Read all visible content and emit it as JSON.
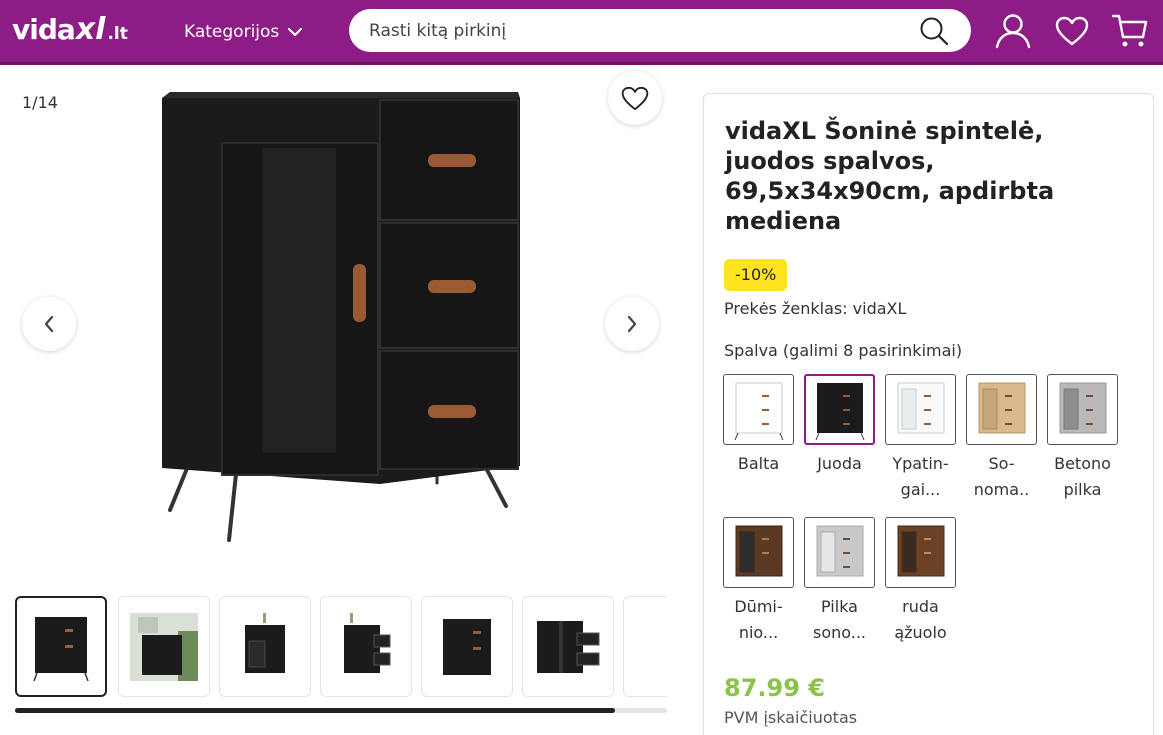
{
  "header": {
    "logo": {
      "vida": "vida",
      "xl": "xl",
      "domain": ".lt"
    },
    "categories_label": "Kategorijos",
    "search_placeholder": "Rasti kitą pirkinį"
  },
  "gallery": {
    "counter": "1/14",
    "thumbnail_count": 7,
    "scroll_progress": 0.92
  },
  "product": {
    "title": "vidaXL Šoninė spintelė, juodos spalvos, 69,5x34x90cm, apdirbta mediena",
    "discount_badge": "-10%",
    "brand_line": "Prekės ženklas: vidaXL",
    "variant_heading": "Spalva (galimi 8 pasirinkimai)",
    "variants": [
      {
        "line1": "Balta",
        "line2": "",
        "color": "#ffffff"
      },
      {
        "line1": "Juoda",
        "line2": "",
        "color": "#1c1c1c"
      },
      {
        "line1": "Ypatin-",
        "line2": "gai...",
        "color": "#fafafa"
      },
      {
        "line1": "So-",
        "line2": "noma..",
        "color": "#d9b98d"
      },
      {
        "line1": "Betono",
        "line2": "pilka",
        "color": "#b9b9b9"
      },
      {
        "line1": "Dūmi-",
        "line2": "nio...",
        "color": "#5a3a24"
      },
      {
        "line1": "Pilka",
        "line2": "sono...",
        "color": "#c9c9c9"
      },
      {
        "line1": "ruda",
        "line2": "ąžuolo",
        "color": "#6b4226"
      }
    ],
    "selected_variant": "Juoda",
    "price": "87.99 €",
    "vat_note": "PVM įskaičiuotas"
  },
  "colors": {
    "brand_purple": "#8e1c86",
    "price_green": "#8bc34a",
    "badge_yellow": "#ffe41f"
  }
}
